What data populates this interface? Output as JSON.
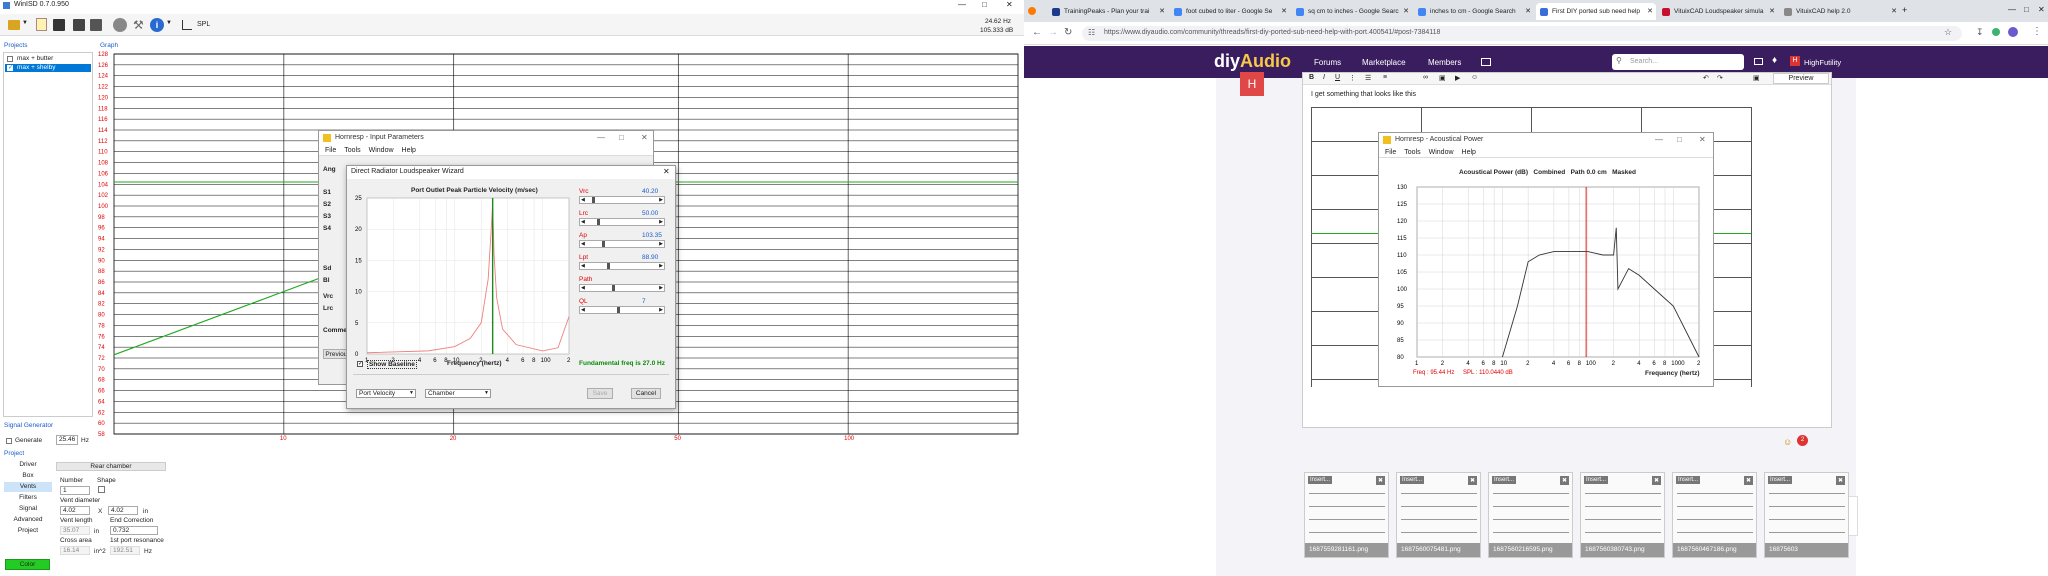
{
  "winisd": {
    "title": "WinISD 0.7.0.950",
    "status_freq": "24.62 Hz",
    "status_value": "105.333 dB",
    "toolbar_label": "SPL",
    "projects_header": "Projects",
    "graph_header": "Graph",
    "projects": [
      {
        "label": "max + butter",
        "checked": false
      },
      {
        "label": "max + shelby",
        "checked": true
      }
    ],
    "y_ticks": [
      "128",
      "126",
      "124",
      "122",
      "120",
      "118",
      "116",
      "114",
      "112",
      "110",
      "108",
      "106",
      "104",
      "102",
      "100",
      "98",
      "96",
      "94",
      "92",
      "90",
      "88",
      "86",
      "84",
      "82",
      "80",
      "78",
      "76",
      "74",
      "72",
      "70",
      "68",
      "66",
      "64",
      "62",
      "60",
      "58"
    ],
    "x_ticks": [
      "10",
      "20",
      "50",
      "100"
    ],
    "signal_generator_header": "Signal Generator",
    "generate_label": "Generate",
    "generate_value": "25.46",
    "generate_unit": "Hz",
    "project_header": "Project",
    "nav": [
      "Driver",
      "Box",
      "Vents",
      "Filters",
      "Signal",
      "Advanced",
      "Project"
    ],
    "nav_active": "Vents",
    "color_label": "Color",
    "rear_chamber": "Rear chamber",
    "number_label": "Number",
    "number_value": "1",
    "shape_label": "Shape",
    "vent_diameter_label": "Vent diameter",
    "vent_d1": "4.02",
    "vent_x": "X",
    "vent_d2": "4.02",
    "vent_unit": "in",
    "vent_length_label": "Vent length",
    "vent_length_value": "35.07",
    "vent_length_unit": "in",
    "end_correction_label": "End Correction",
    "end_correction_value": "0.732",
    "cross_area_label": "Cross area",
    "cross_area_value": "16.14",
    "cross_area_unit": "in^2",
    "port_res_label": "1st port resonance",
    "port_res_value": "192.51",
    "port_res_unit": "Hz"
  },
  "hornresp_input": {
    "title": "Hornresp - Input Parameters",
    "menu": [
      "File",
      "Tools",
      "Window",
      "Help"
    ],
    "labels": [
      "Ang",
      "S1",
      "S2",
      "S3",
      "S4",
      "Sd",
      "Bl",
      "Vrc",
      "Lrc",
      "Comment"
    ],
    "previous": "Previous"
  },
  "wizard": {
    "title": "Direct Radiator Loudspeaker Wizard",
    "chart_title": "Port Outlet Peak Particle Velocity (m/sec)",
    "sliders": [
      {
        "name": "Vrc",
        "value": "40.20"
      },
      {
        "name": "Lrc",
        "value": "50.00"
      },
      {
        "name": "Ap",
        "value": "103.35"
      },
      {
        "name": "Lpt",
        "value": "88.90"
      },
      {
        "name": "Path",
        "value": ""
      },
      {
        "name": "QL",
        "value": "7"
      }
    ],
    "show_baseline": "Show Baseline",
    "xlabel": "Frequency (hertz)",
    "fundamental": "Fundamental freq is 27.0 Hz",
    "select1": "Port Velocity",
    "select2": "Chamber",
    "save": "Save",
    "cancel": "Cancel",
    "y_ticks": [
      "25",
      "20",
      "15",
      "10",
      "5",
      "0"
    ],
    "x_ticks": [
      "1",
      "2",
      "4",
      "6",
      "8",
      "10",
      "2",
      "4",
      "6",
      "8",
      "100",
      "2"
    ]
  },
  "browser": {
    "tabs": [
      {
        "label": "TrainingPeaks - Plan your trai",
        "color": "#1b3a8a"
      },
      {
        "label": "foot cubed to liter - Google Se",
        "color": "#4285f4"
      },
      {
        "label": "sq cm to inches - Google Searc",
        "color": "#4285f4"
      },
      {
        "label": "inches to cm - Google Search",
        "color": "#4285f4"
      },
      {
        "label": "First DIY ported sub need help",
        "color": "#3a6fd8"
      },
      {
        "label": "VituixCAD Loudspeaker simula",
        "color": "#c8102e"
      },
      {
        "label": "VituixCAD help 2.0",
        "color": "#888888"
      }
    ],
    "url": "https://www.diyaudio.com/community/threads/first-diy-ported-sub-need-help-with-port.400541/#post-7384118",
    "logo_a": "diy",
    "logo_b": "Audio",
    "nav": [
      "Forums",
      "Marketplace",
      "Members"
    ],
    "search_placeholder": "Search...",
    "user": "HighFutility",
    "preview": "Preview",
    "post_text": "I get something that looks like this",
    "thumbs": [
      "1687559281161.png",
      "1687560075481.png",
      "1687560216595.png",
      "1687560380743.png",
      "1687560467186.png",
      "16875603"
    ],
    "insert_label": "Insert..."
  },
  "acoustic": {
    "title": "Hornresp - Acoustical Power",
    "menu": [
      "File",
      "Tools",
      "Window",
      "Help"
    ],
    "chart_title": "Acoustical Power (dB)   Combined   Path 0.0 cm   Masked",
    "y_ticks": [
      "130",
      "125",
      "120",
      "115",
      "110",
      "105",
      "100",
      "95",
      "90",
      "85",
      "80"
    ],
    "x_ticks": [
      "1",
      "2",
      "4",
      "6",
      "8",
      "10",
      "2",
      "4",
      "6",
      "8",
      "100",
      "2",
      "4",
      "6",
      "8",
      "1000",
      "2"
    ],
    "xlabel": "Frequency (hertz)",
    "freq_readout": "Freq : 95.44 Hz",
    "spl_readout": "SPL : 110.0440 dB"
  },
  "chart_data": [
    {
      "type": "line",
      "title": "",
      "xlabel": "",
      "ylabel": "",
      "x_scale": "log",
      "xlim": [
        5,
        200
      ],
      "ylim": [
        57,
        129
      ],
      "series": [
        {
          "name": "",
          "x": [
            5,
            10,
            20,
            27
          ],
          "y": [
            72,
            84,
            96,
            104
          ]
        }
      ]
    },
    {
      "type": "line",
      "title": "Port Outlet Peak Particle Velocity (m/sec)",
      "xlabel": "Frequency (hertz)",
      "x_scale": "log",
      "xlim": [
        1,
        200
      ],
      "ylim": [
        0,
        25
      ],
      "series": [
        {
          "name": "",
          "x": [
            1,
            5,
            10,
            15,
            20,
            24,
            26,
            27,
            28,
            30,
            35,
            50,
            100,
            150,
            200
          ],
          "y": [
            0.2,
            0.5,
            1.2,
            2.5,
            5,
            12,
            20,
            24,
            16,
            9,
            4,
            1.5,
            0.5,
            1,
            6
          ]
        }
      ]
    },
    {
      "type": "line",
      "title": "Acoustical Power (dB)",
      "xlabel": "Frequency (hertz)",
      "x_scale": "log",
      "xlim": [
        1,
        2000
      ],
      "ylim": [
        80,
        130
      ],
      "series": [
        {
          "name": "",
          "x": [
            10,
            15,
            20,
            27,
            40,
            60,
            100,
            150,
            200,
            215,
            225,
            300,
            400,
            600,
            1000,
            2000
          ],
          "y": [
            80,
            95,
            108,
            110,
            111,
            111,
            111,
            110,
            110,
            118,
            100,
            106,
            104,
            100,
            95,
            80
          ]
        }
      ]
    }
  ]
}
